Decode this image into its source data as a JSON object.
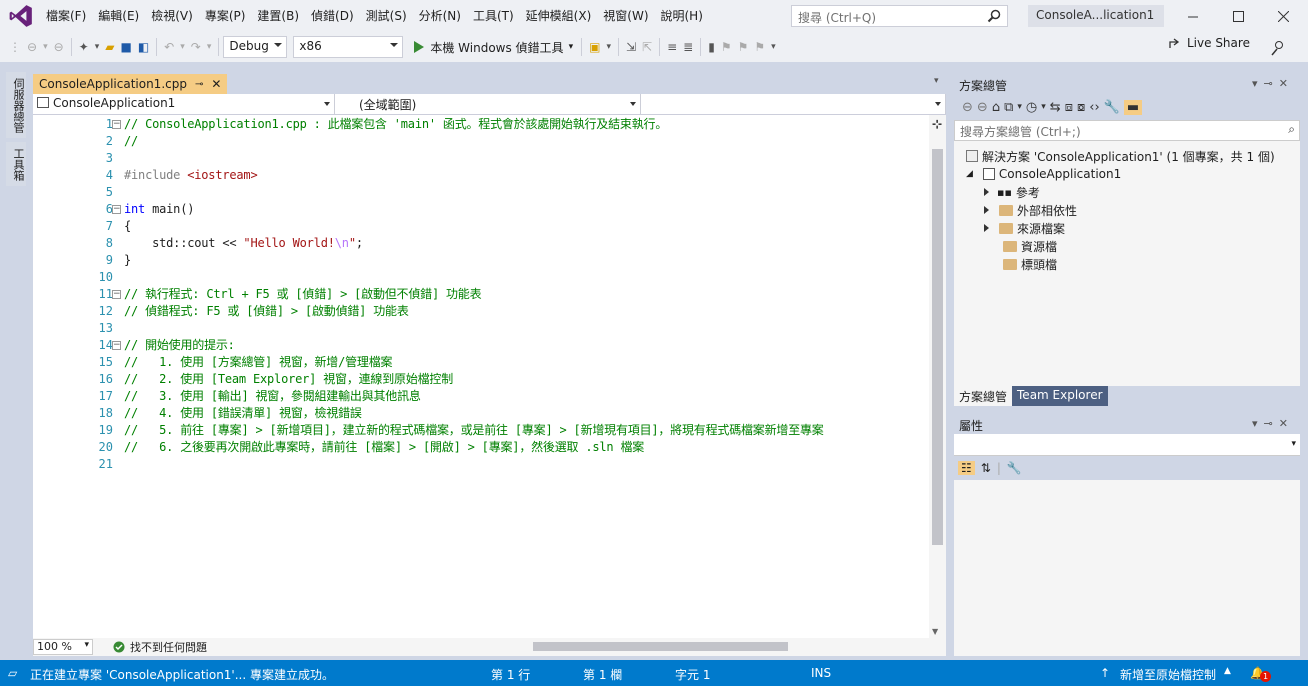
{
  "menu": {
    "items": [
      "檔案(F)",
      "編輯(E)",
      "檢視(V)",
      "專案(P)",
      "建置(B)",
      "偵錯(D)",
      "測試(S)",
      "分析(N)",
      "工具(T)",
      "延伸模組(X)",
      "視窗(W)",
      "說明(H)"
    ],
    "search_placeholder": "搜尋 (Ctrl+Q)",
    "window_title": "ConsoleA...lication1"
  },
  "toolbar": {
    "configuration": "Debug",
    "platform": "x86",
    "debugger_label": "本機 Windows 偵錯工具",
    "live_share": "Live Share"
  },
  "left_strip": {
    "tabs": [
      "伺服器總管",
      "工具箱"
    ]
  },
  "document": {
    "tab_title": "ConsoleApplication1.cpp",
    "nav_project": "ConsoleApplication1",
    "nav_scope": "(全域範圍)",
    "nav_member": ""
  },
  "code": {
    "line_numbers": [
      "1",
      "2",
      "3",
      "4",
      "5",
      "6",
      "7",
      "8",
      "9",
      "10",
      "11",
      "12",
      "13",
      "14",
      "15",
      "16",
      "17",
      "18",
      "19",
      "20",
      "21"
    ],
    "lines": [
      [
        {
          "t": "// ConsoleApplication1.cpp : 此檔案包含 'main' 函式。程式會於該處開始執行及結束執行。",
          "c": "cm"
        }
      ],
      [
        {
          "t": "//",
          "c": "cm"
        }
      ],
      [],
      [
        {
          "t": "#include ",
          "c": "pp"
        },
        {
          "t": "<iostream>",
          "c": "str"
        }
      ],
      [],
      [
        {
          "t": "int",
          "c": "kw"
        },
        {
          "t": " main()",
          "c": "tx"
        }
      ],
      [
        {
          "t": "{",
          "c": "tx"
        }
      ],
      [
        {
          "t": "    std::cout << ",
          "c": "tx"
        },
        {
          "t": "\"Hello World!",
          "c": "str"
        },
        {
          "t": "\\n",
          "c": "esc"
        },
        {
          "t": "\"",
          "c": "str"
        },
        {
          "t": ";",
          "c": "tx"
        }
      ],
      [
        {
          "t": "}",
          "c": "tx"
        }
      ],
      [],
      [
        {
          "t": "// 執行程式: Ctrl + F5 或 [偵錯] > [啟動但不偵錯] 功能表",
          "c": "cm"
        }
      ],
      [
        {
          "t": "// 偵錯程式: F5 或 [偵錯] > [啟動偵錯] 功能表",
          "c": "cm"
        }
      ],
      [],
      [
        {
          "t": "// 開始使用的提示:",
          "c": "cm"
        }
      ],
      [
        {
          "t": "//   1. 使用 [方案總管] 視窗，新增/管理檔案",
          "c": "cm"
        }
      ],
      [
        {
          "t": "//   2. 使用 [Team Explorer] 視窗，連線到原始檔控制",
          "c": "cm"
        }
      ],
      [
        {
          "t": "//   3. 使用 [輸出] 視窗，參閱組建輸出與其他訊息",
          "c": "cm"
        }
      ],
      [
        {
          "t": "//   4. 使用 [錯誤清單] 視窗，檢視錯誤",
          "c": "cm"
        }
      ],
      [
        {
          "t": "//   5. 前往 [專案] > [新增項目]，建立新的程式碼檔案，或是前往 [專案] > [新增現有項目]，將現有程式碼檔案新增至專案",
          "c": "cm"
        }
      ],
      [
        {
          "t": "//   6. 之後要再次開啟此專案時，請前往 [檔案] > [開啟] > [專案]，然後選取 .sln 檔案",
          "c": "cm"
        }
      ],
      []
    ]
  },
  "editor_status": {
    "zoom": "100 %",
    "issues": "找不到任何問題"
  },
  "solution_explorer": {
    "title": "方案總管",
    "search_placeholder": "搜尋方案總管 (Ctrl+;)",
    "solution_label": "解決方案 'ConsoleApplication1' (1 個專案，共 1 個)",
    "project_label": "ConsoleApplication1",
    "nodes": [
      "參考",
      "外部相依性",
      "來源檔案",
      "資源檔",
      "標頭檔"
    ]
  },
  "panel_tabs": [
    "方案總管",
    "Team Explorer"
  ],
  "properties": {
    "title": "屬性"
  },
  "statusbar": {
    "message": "正在建立專案 'ConsoleApplication1'... 專案建立成功。",
    "line": "第 1 行",
    "column": "第 1 欄",
    "char": "字元 1",
    "mode": "INS",
    "source_control": "新增至原始檔控制",
    "notification_count": "1"
  },
  "colors": {
    "accent": "#007acc",
    "chrome": "#eef0f4",
    "panel_bg": "#cfd6e5",
    "active_tab": "#f5cc84",
    "comment": "#008000",
    "keyword": "#0000ff",
    "string": "#a31515"
  }
}
